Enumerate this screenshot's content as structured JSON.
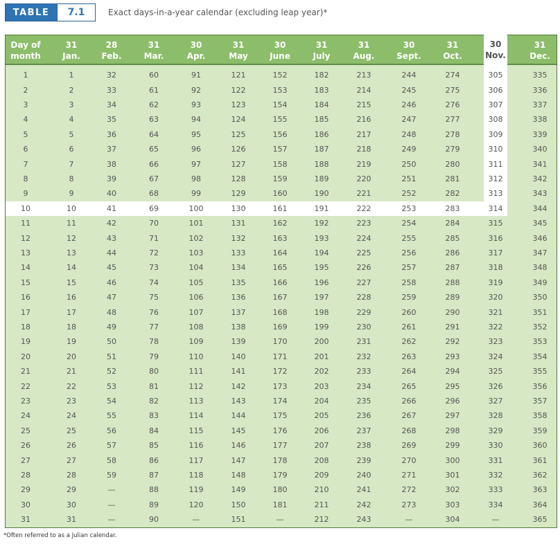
{
  "title": {
    "label": "TABLE",
    "number": "7.1",
    "caption": "Exact days-in-a-year calendar (excluding leap year)*"
  },
  "header": {
    "first": [
      "Day of",
      "month"
    ],
    "months": [
      {
        "days": "31",
        "name": "Jan."
      },
      {
        "days": "28",
        "name": "Feb."
      },
      {
        "days": "31",
        "name": "Mar."
      },
      {
        "days": "30",
        "name": "Apr."
      },
      {
        "days": "31",
        "name": "May"
      },
      {
        "days": "30",
        "name": "June"
      },
      {
        "days": "31",
        "name": "July"
      },
      {
        "days": "31",
        "name": "Aug."
      },
      {
        "days": "30",
        "name": "Sept."
      },
      {
        "days": "31",
        "name": "Oct."
      },
      {
        "days": "30",
        "name": "Nov."
      },
      {
        "days": "31",
        "name": "Dec."
      }
    ]
  },
  "highlight": {
    "row_day": 10,
    "column": "Nov.",
    "colors": {
      "header_green": "#8cbd6a",
      "body_green": "#d6e8c4",
      "highlight": "#ffffff",
      "title_blue": "#2e74b5"
    }
  },
  "rows": [
    [
      "1",
      "1",
      "32",
      "60",
      "91",
      "121",
      "152",
      "182",
      "213",
      "244",
      "274",
      "305",
      "335"
    ],
    [
      "2",
      "2",
      "33",
      "61",
      "92",
      "122",
      "153",
      "183",
      "214",
      "245",
      "275",
      "306",
      "336"
    ],
    [
      "3",
      "3",
      "34",
      "62",
      "93",
      "123",
      "154",
      "184",
      "215",
      "246",
      "276",
      "307",
      "337"
    ],
    [
      "4",
      "4",
      "35",
      "63",
      "94",
      "124",
      "155",
      "185",
      "216",
      "247",
      "277",
      "308",
      "338"
    ],
    [
      "5",
      "5",
      "36",
      "64",
      "95",
      "125",
      "156",
      "186",
      "217",
      "248",
      "278",
      "309",
      "339"
    ],
    [
      "6",
      "6",
      "37",
      "65",
      "96",
      "126",
      "157",
      "187",
      "218",
      "249",
      "279",
      "310",
      "340"
    ],
    [
      "7",
      "7",
      "38",
      "66",
      "97",
      "127",
      "158",
      "188",
      "219",
      "250",
      "280",
      "311",
      "341"
    ],
    [
      "8",
      "8",
      "39",
      "67",
      "98",
      "128",
      "159",
      "189",
      "220",
      "251",
      "281",
      "312",
      "342"
    ],
    [
      "9",
      "9",
      "40",
      "68",
      "99",
      "129",
      "160",
      "190",
      "221",
      "252",
      "282",
      "313",
      "343"
    ],
    [
      "10",
      "10",
      "41",
      "69",
      "100",
      "130",
      "161",
      "191",
      "222",
      "253",
      "283",
      "314",
      "344"
    ],
    [
      "11",
      "11",
      "42",
      "70",
      "101",
      "131",
      "162",
      "192",
      "223",
      "254",
      "284",
      "315",
      "345"
    ],
    [
      "12",
      "12",
      "43",
      "71",
      "102",
      "132",
      "163",
      "193",
      "224",
      "255",
      "285",
      "316",
      "346"
    ],
    [
      "13",
      "13",
      "44",
      "72",
      "103",
      "133",
      "164",
      "194",
      "225",
      "256",
      "286",
      "317",
      "347"
    ],
    [
      "14",
      "14",
      "45",
      "73",
      "104",
      "134",
      "165",
      "195",
      "226",
      "257",
      "287",
      "318",
      "348"
    ],
    [
      "15",
      "15",
      "46",
      "74",
      "105",
      "135",
      "166",
      "196",
      "227",
      "258",
      "288",
      "319",
      "349"
    ],
    [
      "16",
      "16",
      "47",
      "75",
      "106",
      "136",
      "167",
      "197",
      "228",
      "259",
      "289",
      "320",
      "350"
    ],
    [
      "17",
      "17",
      "48",
      "76",
      "107",
      "137",
      "168",
      "198",
      "229",
      "260",
      "290",
      "321",
      "351"
    ],
    [
      "18",
      "18",
      "49",
      "77",
      "108",
      "138",
      "169",
      "199",
      "230",
      "261",
      "291",
      "322",
      "352"
    ],
    [
      "19",
      "19",
      "50",
      "78",
      "109",
      "139",
      "170",
      "200",
      "231",
      "262",
      "292",
      "323",
      "353"
    ],
    [
      "20",
      "20",
      "51",
      "79",
      "110",
      "140",
      "171",
      "201",
      "232",
      "263",
      "293",
      "324",
      "354"
    ],
    [
      "21",
      "21",
      "52",
      "80",
      "111",
      "141",
      "172",
      "202",
      "233",
      "264",
      "294",
      "325",
      "355"
    ],
    [
      "22",
      "22",
      "53",
      "81",
      "112",
      "142",
      "173",
      "203",
      "234",
      "265",
      "295",
      "326",
      "356"
    ],
    [
      "23",
      "23",
      "54",
      "82",
      "113",
      "143",
      "174",
      "204",
      "235",
      "266",
      "296",
      "327",
      "357"
    ],
    [
      "24",
      "24",
      "55",
      "83",
      "114",
      "144",
      "175",
      "205",
      "236",
      "267",
      "297",
      "328",
      "358"
    ],
    [
      "25",
      "25",
      "56",
      "84",
      "115",
      "145",
      "176",
      "206",
      "237",
      "268",
      "298",
      "329",
      "359"
    ],
    [
      "26",
      "26",
      "57",
      "85",
      "116",
      "146",
      "177",
      "207",
      "238",
      "269",
      "299",
      "330",
      "360"
    ],
    [
      "27",
      "27",
      "58",
      "86",
      "117",
      "147",
      "178",
      "208",
      "239",
      "270",
      "300",
      "331",
      "361"
    ],
    [
      "28",
      "28",
      "59",
      "87",
      "118",
      "148",
      "179",
      "209",
      "240",
      "271",
      "301",
      "332",
      "362"
    ],
    [
      "29",
      "29",
      "—",
      "88",
      "119",
      "149",
      "180",
      "210",
      "241",
      "272",
      "302",
      "333",
      "363"
    ],
    [
      "30",
      "30",
      "—",
      "89",
      "120",
      "150",
      "181",
      "211",
      "242",
      "273",
      "303",
      "334",
      "364"
    ],
    [
      "31",
      "31",
      "—",
      "90",
      "—",
      "151",
      "—",
      "212",
      "243",
      "—",
      "304",
      "—",
      "365"
    ]
  ],
  "footnote": "*Often referred to as a Julian calendar."
}
